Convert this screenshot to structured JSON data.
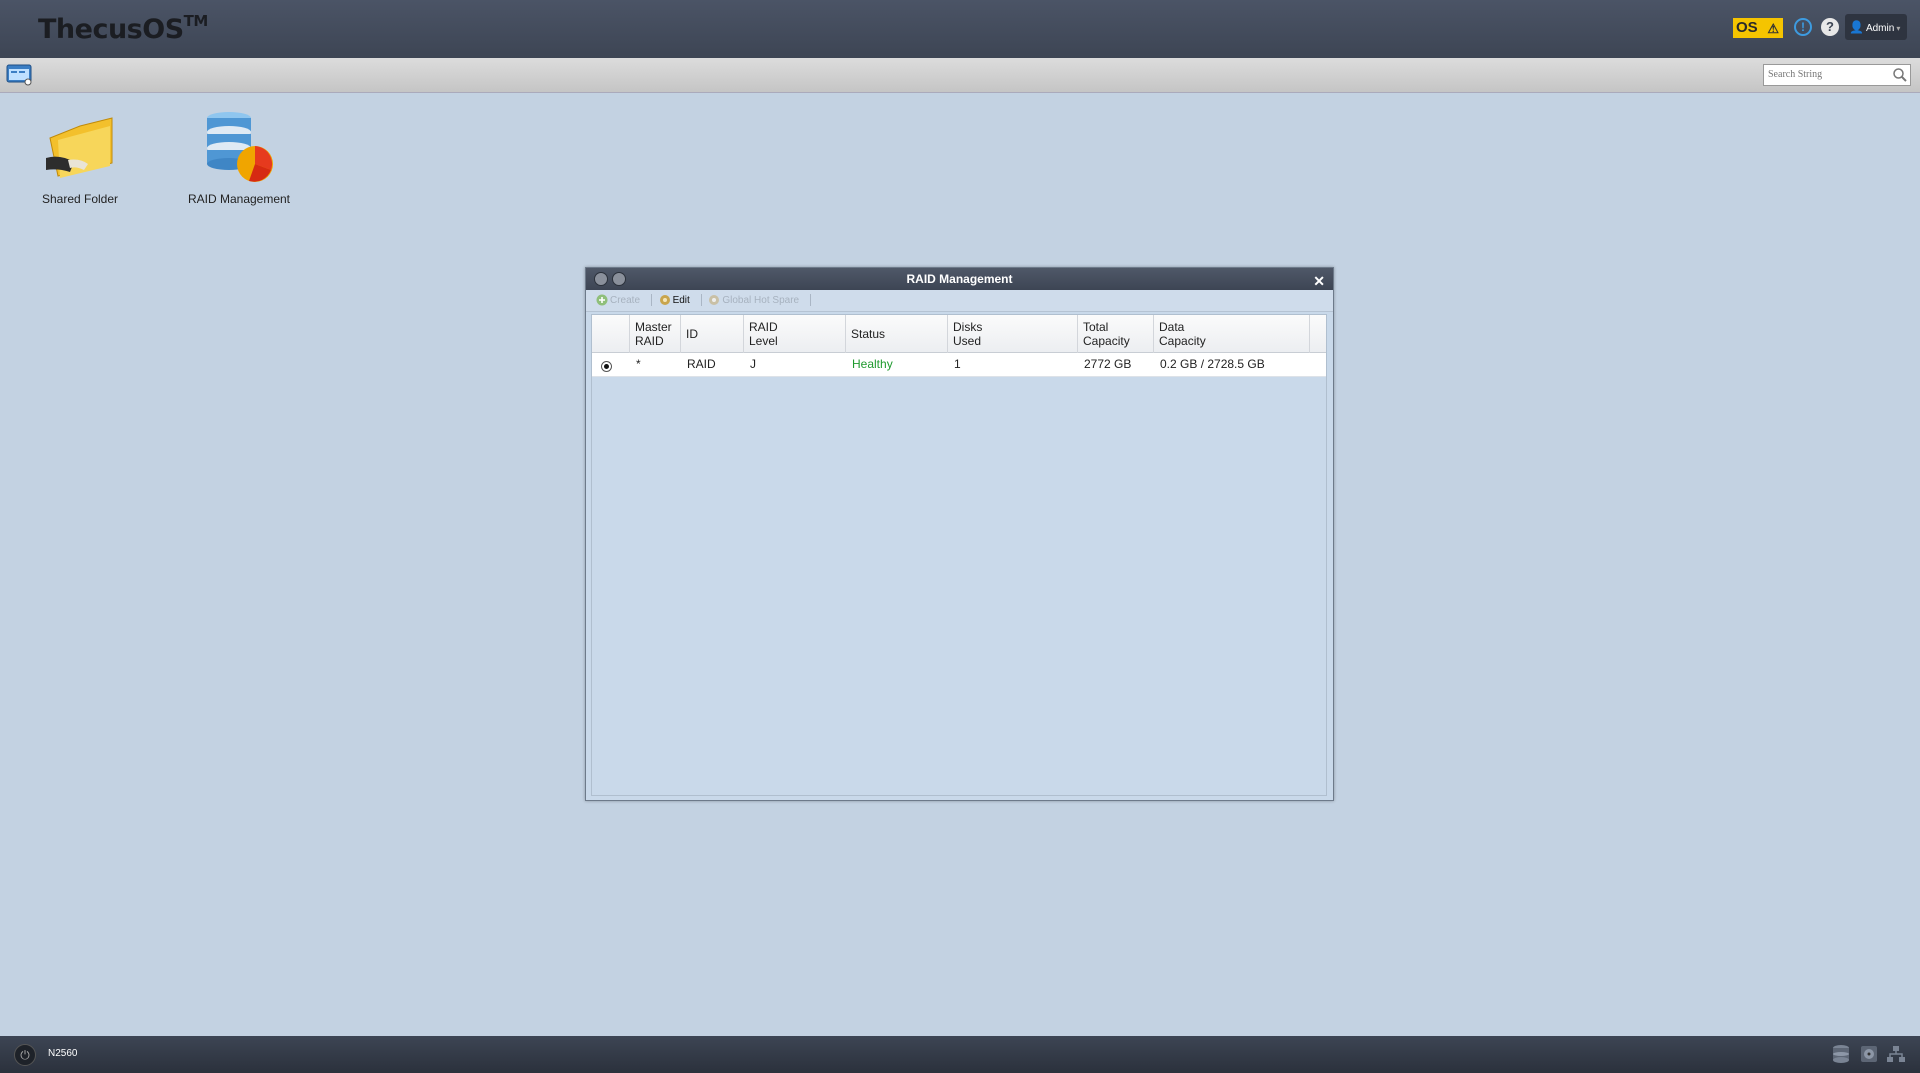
{
  "header": {
    "logo": "ThecusOS",
    "logo_tm": "TM",
    "os_badge": "OS",
    "info_glyph": "!",
    "help_glyph": "?",
    "user": "Admin"
  },
  "subbar": {
    "search_placeholder": "Search String"
  },
  "desktop": {
    "icons": [
      {
        "label": "Shared Folder",
        "icon": "shared-folder-icon"
      },
      {
        "label": "RAID Management",
        "icon": "raid-management-icon"
      }
    ]
  },
  "window": {
    "title": "RAID Management",
    "toolbar": {
      "create": "Create",
      "edit": "Edit",
      "global_hot_spare": "Global Hot Spare"
    },
    "columns": [
      {
        "line1": "Master",
        "line2": "RAID"
      },
      {
        "line1": "ID",
        "line2": ""
      },
      {
        "line1": "RAID",
        "line2": "Level"
      },
      {
        "line1": "Status",
        "line2": ""
      },
      {
        "line1": "Disks",
        "line2": "Used"
      },
      {
        "line1": "Total",
        "line2": "Capacity"
      },
      {
        "line1": "Data",
        "line2": "Capacity"
      }
    ],
    "rows": [
      {
        "master": "*",
        "id": "RAID",
        "level": "J",
        "status": "Healthy",
        "disks": "1",
        "total": "2772 GB",
        "data": "0.2 GB / 2728.5 GB"
      }
    ]
  },
  "bottombar": {
    "device": "N2560"
  },
  "colors": {
    "desktop_bg": "#c3d2e2",
    "header_bg": "#444c5c",
    "healthy": "#1f9a2e",
    "os_badge": "#f5c400"
  }
}
